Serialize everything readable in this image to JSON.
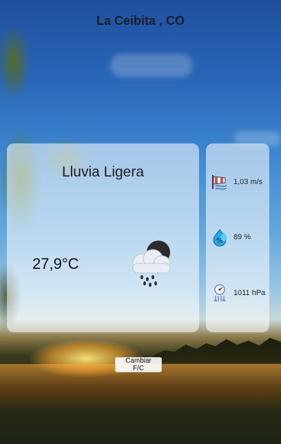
{
  "location": {
    "title": "La Ceibita , CO"
  },
  "weather": {
    "condition": "Lluvia Ligera",
    "temperature": "27,9°C",
    "icon": "night-rain-cloud-icon"
  },
  "metrics": [
    {
      "name": "wind",
      "icon": "windsock-icon",
      "value": "1,03 m/s"
    },
    {
      "name": "humidity",
      "icon": "humidity-drop-icon",
      "value": "89 %"
    },
    {
      "name": "pressure",
      "icon": "pressure-gauge-icon",
      "value": "1011 hPa"
    }
  ],
  "controls": {
    "toggle_units_label": "Cambiar F/C"
  },
  "colors": {
    "text_dark": "#1b1f2a",
    "card_bg": "rgba(255,255,255,0.55)"
  }
}
